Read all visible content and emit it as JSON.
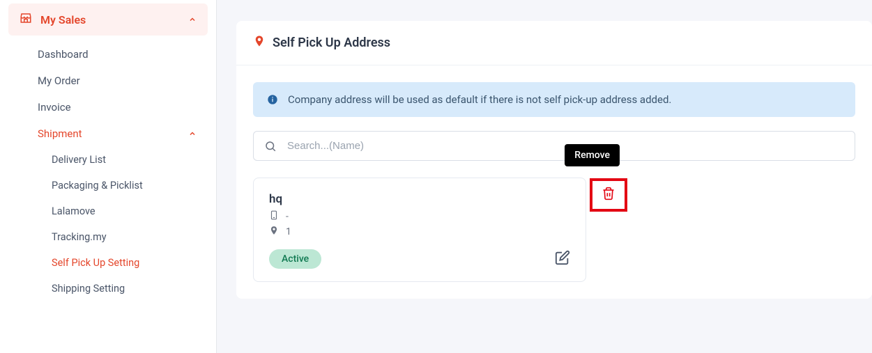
{
  "sidebar": {
    "header": "My Sales",
    "items": [
      {
        "label": "Dashboard"
      },
      {
        "label": "My Order"
      },
      {
        "label": "Invoice"
      },
      {
        "label": "Shipment",
        "expanded": true,
        "children": [
          {
            "label": "Delivery List"
          },
          {
            "label": "Packaging & Picklist"
          },
          {
            "label": "Lalamove"
          },
          {
            "label": "Tracking.my"
          },
          {
            "label": "Self Pick Up Setting",
            "active": true
          },
          {
            "label": "Shipping Setting"
          }
        ]
      }
    ]
  },
  "panel": {
    "title": "Self Pick Up Address",
    "alert": "Company address will be used as default if there is not self pick-up address added.",
    "search_placeholder": "Search...(Name)"
  },
  "tooltip": "Remove",
  "card": {
    "title": "hq",
    "phone": "-",
    "location": "1",
    "status": "Active"
  }
}
